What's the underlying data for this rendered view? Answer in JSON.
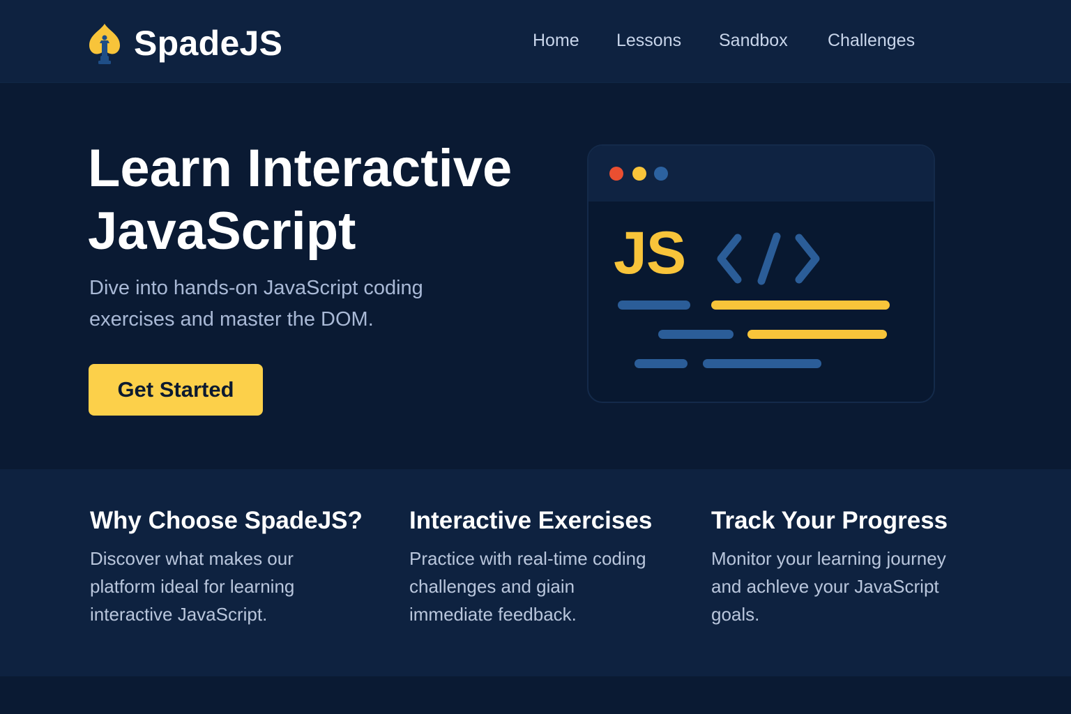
{
  "brand": {
    "name": "SpadeJS",
    "logo_icon": "spade-icon"
  },
  "nav": {
    "items": [
      {
        "label": "Home"
      },
      {
        "label": "Lessons"
      },
      {
        "label": "Sandbox"
      },
      {
        "label": "Challenges"
      }
    ]
  },
  "hero": {
    "title_line1": "Learn Interactive",
    "title_line2": "JavaScript",
    "subtitle": "Dive into hands-on JavaScript coding exercises and master the DOM.",
    "cta_label": "Get Started",
    "illustration": {
      "label": "JS",
      "tag_icon": "code-tag-icon",
      "window_dots": [
        "#ea4f31",
        "#f8c43a",
        "#2c62a0"
      ]
    }
  },
  "features": [
    {
      "title": "Why Choose SpadeJS?",
      "text": "Discover what makes our platform ideal for learning interactive JavaScript."
    },
    {
      "title": "Interactive Exercises",
      "text": "Practice with real-time coding challenges and giain immediate feedback."
    },
    {
      "title": "Track Your Progress",
      "text": "Monitor your learning journey and achleve your JavaScript goals."
    }
  ],
  "colors": {
    "background": "#0a1a33",
    "navbar": "#0e2240",
    "accent_yellow": "#fcd04a",
    "accent_blue": "#2b5d98",
    "dot_red": "#ea4f31"
  }
}
